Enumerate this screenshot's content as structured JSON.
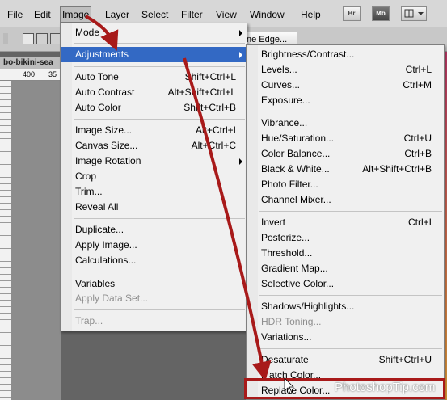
{
  "menubar": {
    "items": [
      "File",
      "Edit",
      "Image",
      "Layer",
      "Select",
      "Filter",
      "View",
      "Window",
      "Help"
    ],
    "bridge_label": "Br",
    "minibridge_label": "Mb"
  },
  "options_bar": {
    "refine_edge_label": "ne Edge..."
  },
  "document": {
    "tab_title": "bo-bikini-sea",
    "ruler_ticks": [
      "400",
      "35"
    ]
  },
  "image_menu": {
    "mode": "Mode",
    "adjustments": "Adjustments",
    "auto_tone": {
      "label": "Auto Tone",
      "shortcut": "Shift+Ctrl+L"
    },
    "auto_contrast": {
      "label": "Auto Contrast",
      "shortcut": "Alt+Shift+Ctrl+L"
    },
    "auto_color": {
      "label": "Auto Color",
      "shortcut": "Shift+Ctrl+B"
    },
    "image_size": {
      "label": "Image Size...",
      "shortcut": "Alt+Ctrl+I"
    },
    "canvas_size": {
      "label": "Canvas Size...",
      "shortcut": "Alt+Ctrl+C"
    },
    "image_rotation": "Image Rotation",
    "crop": "Crop",
    "trim": "Trim...",
    "reveal_all": "Reveal All",
    "duplicate": "Duplicate...",
    "apply_image": "Apply Image...",
    "calculations": "Calculations...",
    "variables": "Variables",
    "apply_data_set": "Apply Data Set...",
    "trap": "Trap..."
  },
  "adjustments_menu": {
    "brightness_contrast": {
      "label": "Brightness/Contrast...",
      "shortcut": ""
    },
    "levels": {
      "label": "Levels...",
      "shortcut": "Ctrl+L"
    },
    "curves": {
      "label": "Curves...",
      "shortcut": "Ctrl+M"
    },
    "exposure": {
      "label": "Exposure...",
      "shortcut": ""
    },
    "vibrance": {
      "label": "Vibrance...",
      "shortcut": ""
    },
    "hue_saturation": {
      "label": "Hue/Saturation...",
      "shortcut": "Ctrl+U"
    },
    "color_balance": {
      "label": "Color Balance...",
      "shortcut": "Ctrl+B"
    },
    "black_white": {
      "label": "Black & White...",
      "shortcut": "Alt+Shift+Ctrl+B"
    },
    "photo_filter": {
      "label": "Photo Filter...",
      "shortcut": ""
    },
    "channel_mixer": {
      "label": "Channel Mixer...",
      "shortcut": ""
    },
    "invert": {
      "label": "Invert",
      "shortcut": "Ctrl+I"
    },
    "posterize": {
      "label": "Posterize...",
      "shortcut": ""
    },
    "threshold": {
      "label": "Threshold...",
      "shortcut": ""
    },
    "gradient_map": {
      "label": "Gradient Map...",
      "shortcut": ""
    },
    "selective_color": {
      "label": "Selective Color...",
      "shortcut": ""
    },
    "shadows_highlights": {
      "label": "Shadows/Highlights...",
      "shortcut": ""
    },
    "hdr_toning": {
      "label": "HDR Toning...",
      "shortcut": ""
    },
    "variations": {
      "label": "Variations...",
      "shortcut": ""
    },
    "desaturate": {
      "label": "Desaturate",
      "shortcut": "Shift+Ctrl+U"
    },
    "match_color": {
      "label": "Match Color...",
      "shortcut": ""
    },
    "replace_color": {
      "label": "Replace Color...",
      "shortcut": ""
    }
  },
  "watermark": "PhotoshopTip.com",
  "colors": {
    "menu_highlight": "#3369c4",
    "annotation_red": "#a81a1a",
    "menu_bg": "#f0f0f0"
  }
}
